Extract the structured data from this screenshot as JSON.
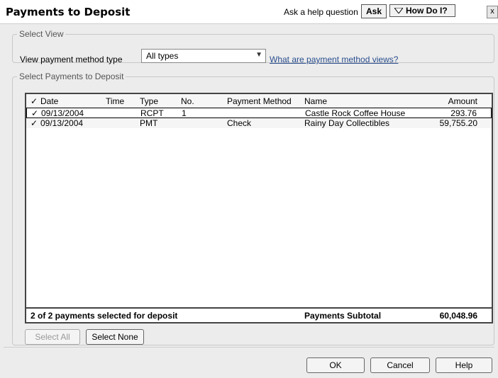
{
  "window": {
    "title": "Payments to Deposit",
    "help_prompt": "Ask a help question",
    "ask_label": "Ask",
    "how_do_i_label": "How Do I?",
    "close_label": "x"
  },
  "select_view": {
    "legend": "Select View",
    "label": "View payment method type",
    "selected_value": "All types",
    "link_text": "What are payment method views?"
  },
  "payments": {
    "legend": "Select Payments to Deposit",
    "columns": [
      "Date",
      "Time",
      "Type",
      "No.",
      "Payment Method",
      "Name",
      "Amount"
    ],
    "check_header": "✓",
    "rows": [
      {
        "checked": "✓",
        "date": "09/13/2004",
        "time": "",
        "type": "RCPT",
        "no": "1",
        "payment_method": "",
        "name": "Castle Rock Coffee House",
        "amount": "293.76"
      },
      {
        "checked": "✓",
        "date": "09/13/2004",
        "time": "",
        "type": "PMT",
        "no": "",
        "payment_method": "Check",
        "name": "Rainy Day Collectibles",
        "amount": "59,755.20"
      }
    ],
    "summary_text": "2 of 2 payments selected for deposit",
    "subtotal_label": "Payments Subtotal",
    "subtotal_value": "60,048.96"
  },
  "buttons": {
    "select_all": "Select All",
    "select_none": "Select None",
    "ok": "OK",
    "cancel": "Cancel",
    "help": "Help"
  },
  "colors": {
    "link": "#2a4f8f",
    "background": "#ececec"
  }
}
